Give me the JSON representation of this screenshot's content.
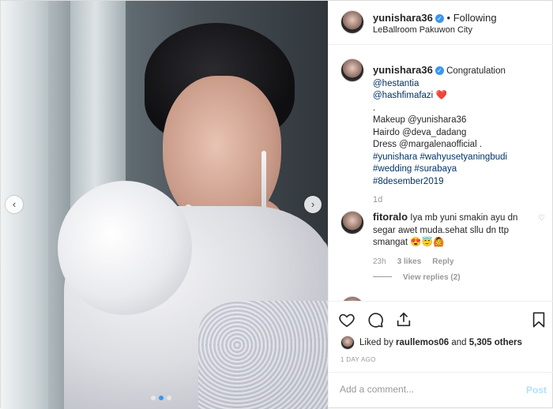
{
  "header": {
    "username": "yunishara36",
    "separator": "•",
    "follow_status": "Following",
    "location": "LeBallroom Pakuwon City"
  },
  "caption": {
    "username": "yunishara36",
    "lines": [
      "Congratulation",
      "@hestantia",
      "@hashfimafazi",
      ".",
      "Makeup @yunishara36",
      "Hairdo @deva_dadang",
      "Dress @margalenaofficial .",
      "#yunishara #wahyusetyaningbudi",
      "#wedding #surabaya",
      "#8desember2019"
    ],
    "heart": "❤️",
    "time": "1d"
  },
  "comment": {
    "username": "fitoralo",
    "text": "Iya mb yuni smakin ayu dn segar awet muda.sehat sllu dn ttp smangat",
    "emoji": "😍😇🙆",
    "time": "23h",
    "likes": "3 likes",
    "reply": "Reply",
    "view_replies": "View replies (2)"
  },
  "likes": {
    "prefix": "Liked by ",
    "user": "raullemos06",
    "middle": " and ",
    "count": "5,305 others"
  },
  "date": "1 DAY AGO",
  "add_comment": {
    "placeholder": "Add a comment...",
    "post": "Post"
  },
  "icons": {
    "heart": "heart-outline-icon",
    "comment": "comment-icon",
    "share": "share-icon",
    "save": "bookmark-icon",
    "prev": "chevron-left-icon",
    "next": "chevron-right-icon"
  },
  "carousel": {
    "total": 3,
    "active": 1
  }
}
